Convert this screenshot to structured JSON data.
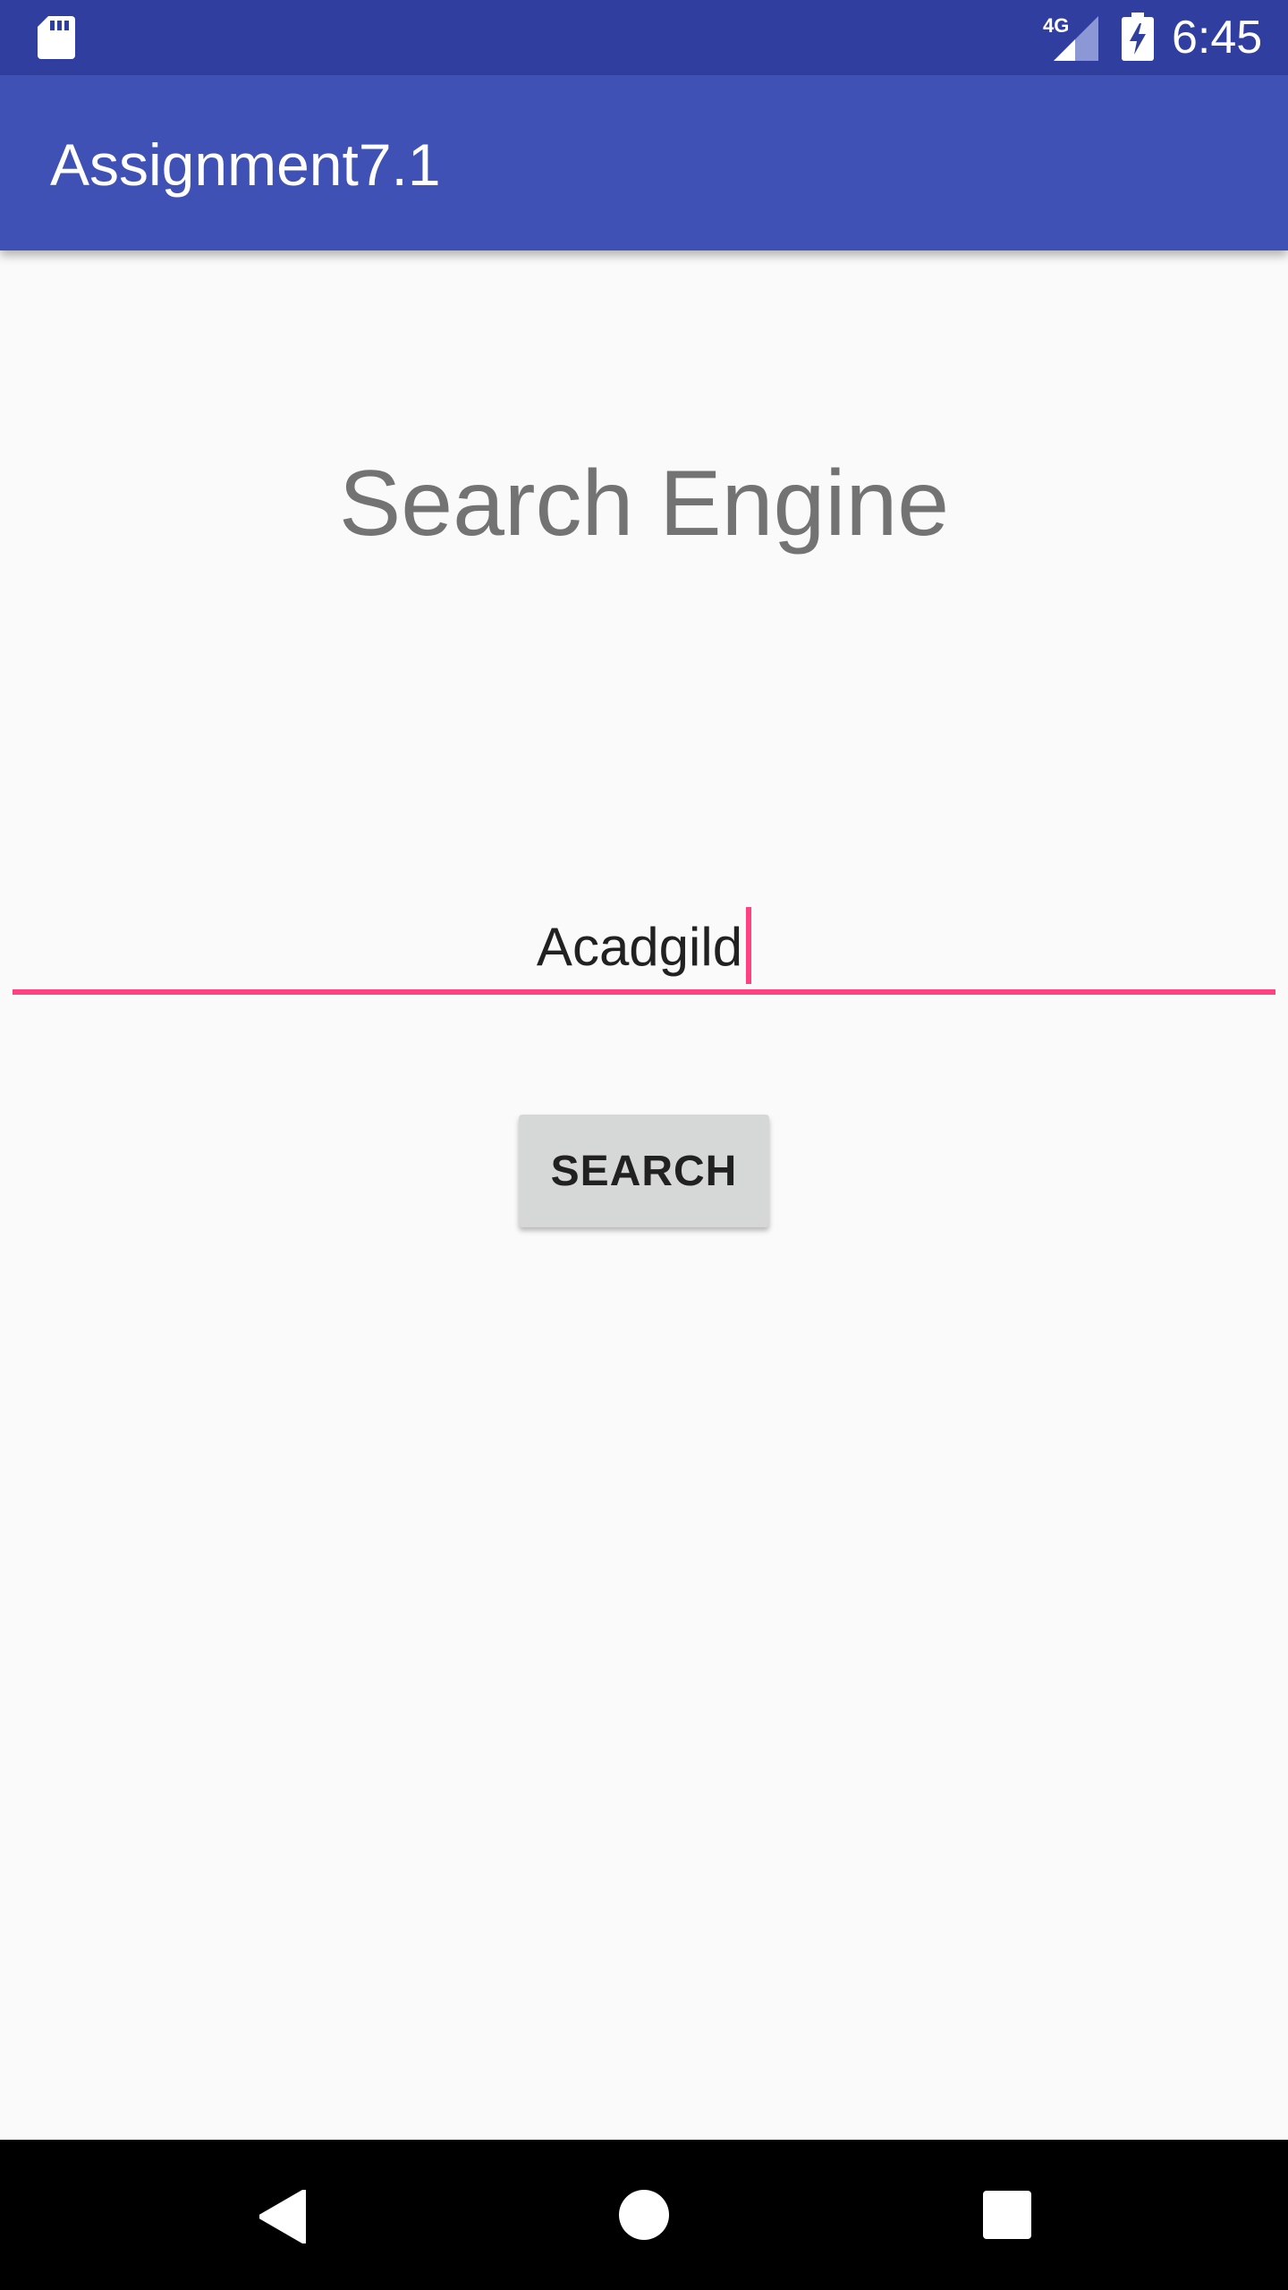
{
  "status_bar": {
    "network_label": "4G",
    "time": "6:45",
    "icons": [
      "sd-card-icon",
      "signal-4g-icon",
      "battery-charging-icon"
    ]
  },
  "app_bar": {
    "title": "Assignment7.1"
  },
  "main": {
    "heading": "Search Engine",
    "search_input": {
      "value": "Acadgild"
    },
    "search_button_label": "SEARCH"
  },
  "nav_bar": {
    "icons": [
      "back-icon",
      "home-icon",
      "recents-icon"
    ]
  },
  "colors": {
    "status_bar": "#303f9f",
    "app_bar": "#3f51b5",
    "accent": "#ff4081",
    "background": "#fafafa",
    "heading_text": "#737373",
    "button": "#d6d7d7"
  }
}
